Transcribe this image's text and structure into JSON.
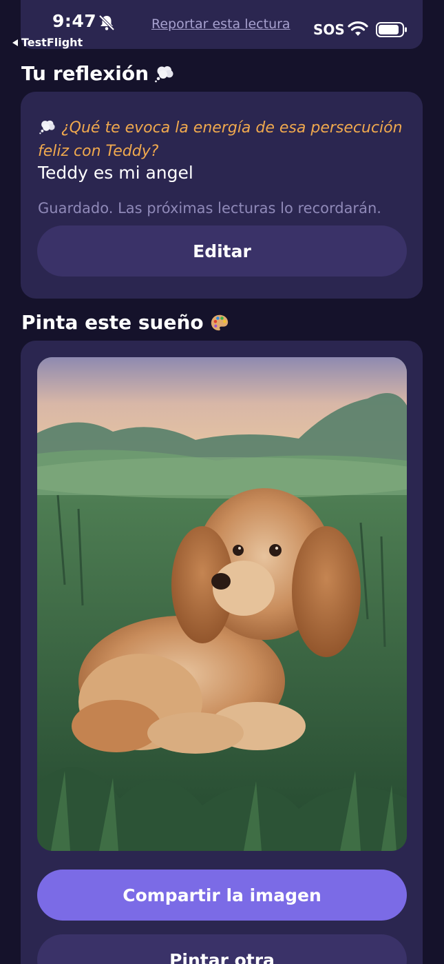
{
  "status_bar": {
    "time": "9:47",
    "back_label": "TestFlight",
    "sos": "SOS",
    "report_link": "Reportar esta lectura"
  },
  "reflection": {
    "title": "Tu reflexión",
    "prompt": "¿Qué te evoca la energía de esa persecución feliz con Teddy?",
    "answer": "Teddy es mi angel",
    "saved_note": "Guardado. Las próximas lecturas lo recordarán.",
    "edit_button": "Editar"
  },
  "paint": {
    "title": "Pinta este sueño",
    "share_button": "Compartir la imagen",
    "paint_another_button": "Pintar otra"
  },
  "colors": {
    "background": "#15122b",
    "card": "#2b2650",
    "accent_button": "#7b6be6",
    "secondary_button": "#3a3268",
    "prompt_text": "#f0a94e"
  }
}
